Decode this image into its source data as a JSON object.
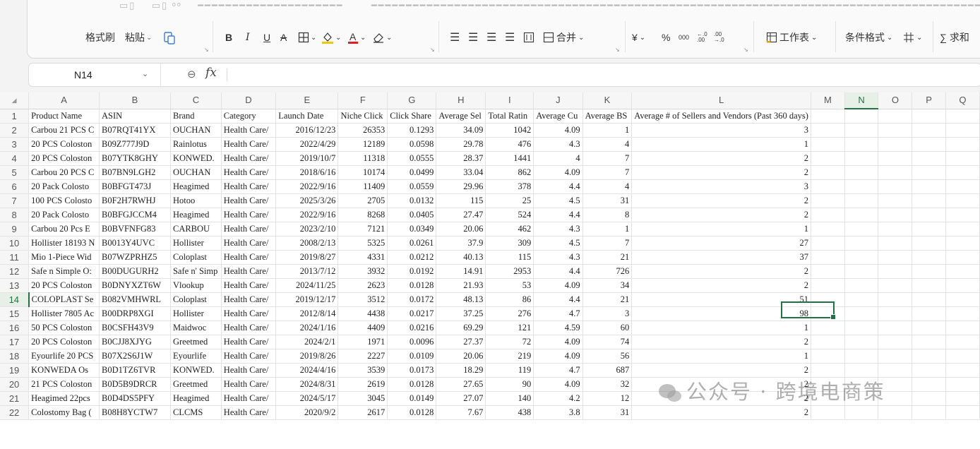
{
  "ribbon": {
    "format_painter": "格式刷",
    "paste": "粘贴",
    "bold": "B",
    "italic": "I",
    "underline": "U",
    "strike": "A",
    "merge": "合并",
    "currency": "¥",
    "percent": "%",
    "thousands": "000",
    "inc_decimal": "←.0\n.00",
    "dec_decimal": ".00\n→.0",
    "worksheet": "工作表",
    "conditional_format": "条件格式",
    "sum": "∑ 求和"
  },
  "formula_bar": {
    "name_box": "N14",
    "fx": "fx",
    "formula": ""
  },
  "columns": [
    "A",
    "B",
    "C",
    "D",
    "E",
    "F",
    "G",
    "H",
    "I",
    "J",
    "K",
    "L",
    "M",
    "N",
    "O",
    "P",
    "Q"
  ],
  "active_column": "N",
  "active_row": "14",
  "header_row": [
    "Product Name",
    "ASIN",
    "Brand",
    "Category",
    "Launch Date",
    "Niche Click",
    "Click Share",
    "Average Sel",
    "Total Ratin",
    "Average Cu",
    "Average BS",
    "Average # of Sellers and Vendors (Past 360 days)"
  ],
  "rows": [
    {
      "n": "2",
      "c": [
        "Carbou 21 PCS C",
        "B07RQT41YX",
        "OUCHAN",
        "Health Care/",
        "2016/12/23",
        "26353",
        "0.1293",
        "34.09",
        "1042",
        "4.09",
        "1",
        "3"
      ]
    },
    {
      "n": "3",
      "c": [
        "20 PCS Coloston",
        "B09Z777J9D",
        "Rainlotus",
        "Health Care/",
        "2022/4/29",
        "12189",
        "0.0598",
        "29.78",
        "476",
        "4.3",
        "4",
        "1"
      ]
    },
    {
      "n": "4",
      "c": [
        "20 PCS Coloston",
        "B07YTK8GHY",
        "KONWED.",
        "Health Care/",
        "2019/10/7",
        "11318",
        "0.0555",
        "28.37",
        "1441",
        "4",
        "7",
        "2"
      ]
    },
    {
      "n": "5",
      "c": [
        "Carbou 20 PCS C",
        "B07BN9LGH2",
        "OUCHAN",
        "Health Care/",
        "2018/6/16",
        "10174",
        "0.0499",
        "33.04",
        "862",
        "4.09",
        "7",
        "2"
      ]
    },
    {
      "n": "6",
      "c": [
        "20 Pack Colosto",
        "B0BFGT473J",
        "Heagimed",
        "Health Care/",
        "2022/9/16",
        "11409",
        "0.0559",
        "29.96",
        "378",
        "4.4",
        "4",
        "3"
      ]
    },
    {
      "n": "7",
      "c": [
        "100 PCS Colosto",
        "B0F2H7RWHJ",
        "Hotoo",
        "Health Care/",
        "2025/3/26",
        "2705",
        "0.0132",
        "115",
        "25",
        "4.5",
        "31",
        "2"
      ]
    },
    {
      "n": "8",
      "c": [
        "20 Pack Colosto",
        "B0BFGJCCM4",
        "Heagimed",
        "Health Care/",
        "2022/9/16",
        "8268",
        "0.0405",
        "27.47",
        "524",
        "4.4",
        "8",
        "2"
      ]
    },
    {
      "n": "9",
      "c": [
        "Carbou 20 Pcs E",
        "B0BVFNFG83",
        "CARBOU",
        "Health Care/",
        "2023/2/10",
        "7121",
        "0.0349",
        "20.06",
        "462",
        "4.3",
        "1",
        "1"
      ]
    },
    {
      "n": "10",
      "c": [
        "Hollister 18193 N",
        "B0013Y4UVC",
        "Hollister",
        "Health Care/",
        "2008/2/13",
        "5325",
        "0.0261",
        "37.9",
        "309",
        "4.5",
        "7",
        "27"
      ]
    },
    {
      "n": "11",
      "c": [
        "Mio 1-Piece Wid",
        "B07WZPRHZ5",
        "Coloplast",
        "Health Care/",
        "2019/8/27",
        "4331",
        "0.0212",
        "40.13",
        "115",
        "4.3",
        "21",
        "37"
      ]
    },
    {
      "n": "12",
      "c": [
        "Safe n Simple O:",
        "B00DUGURH2",
        "Safe n' Simp",
        "Health Care/",
        "2013/7/12",
        "3932",
        "0.0192",
        "14.91",
        "2953",
        "4.4",
        "726",
        "2"
      ]
    },
    {
      "n": "13",
      "c": [
        "20 PCS Coloston",
        "B0DNYXZT6W",
        "Vlookup",
        "Health Care/",
        "2024/11/25",
        "2623",
        "0.0128",
        "21.93",
        "53",
        "4.09",
        "34",
        "2"
      ]
    },
    {
      "n": "14",
      "c": [
        "COLOPLAST Se",
        "B082VMHWRL",
        "Coloplast",
        "Health Care/",
        "2019/12/17",
        "3512",
        "0.0172",
        "48.13",
        "86",
        "4.4",
        "21",
        "51"
      ]
    },
    {
      "n": "15",
      "c": [
        "Hollister 7805 Ac",
        "B00DRP8XGI",
        "Hollister",
        "Health Care/",
        "2012/8/14",
        "4438",
        "0.0217",
        "37.25",
        "276",
        "4.7",
        "3",
        "98"
      ]
    },
    {
      "n": "16",
      "c": [
        "50 PCS Coloston",
        "B0CSFH43V9",
        "Maidwoc",
        "Health Care/",
        "2024/1/16",
        "4409",
        "0.0216",
        "69.29",
        "121",
        "4.59",
        "60",
        "1"
      ]
    },
    {
      "n": "17",
      "c": [
        "20 PCS Coloston",
        "B0CJJ8XJYG",
        "Greetmed",
        "Health Care/",
        "2024/2/1",
        "1971",
        "0.0096",
        "27.37",
        "72",
        "4.09",
        "74",
        "2"
      ]
    },
    {
      "n": "18",
      "c": [
        "Eyourlife 20 PCS",
        "B07X2S6J1W",
        "Eyourlife",
        "Health Care/",
        "2019/8/26",
        "2227",
        "0.0109",
        "20.06",
        "219",
        "4.09",
        "56",
        "1"
      ]
    },
    {
      "n": "19",
      "c": [
        "KONWEDA Os",
        "B0D1TZ6TVR",
        "KONWED.",
        "Health Care/",
        "2024/4/16",
        "3539",
        "0.0173",
        "18.29",
        "119",
        "4.7",
        "687",
        "2"
      ]
    },
    {
      "n": "20",
      "c": [
        "21 PCS Coloston",
        "B0D5B9DRCR",
        "Greetmed",
        "Health Care/",
        "2024/8/31",
        "2619",
        "0.0128",
        "27.65",
        "90",
        "4.09",
        "32",
        "2"
      ]
    },
    {
      "n": "21",
      "c": [
        "Heagimed 22pcs",
        "B0D4DS5PFY",
        "Heagimed",
        "Health Care/",
        "2024/5/17",
        "3045",
        "0.0149",
        "27.07",
        "140",
        "4.2",
        "12",
        "2"
      ]
    },
    {
      "n": "22",
      "c": [
        "Colostomy Bag (",
        "B08H8YCTW7",
        "CLCMS",
        "Health Care/",
        "2020/9/2",
        "2617",
        "0.0128",
        "7.67",
        "438",
        "3.8",
        "31",
        "2"
      ]
    }
  ],
  "watermark": "公众号 · 跨境电商策"
}
